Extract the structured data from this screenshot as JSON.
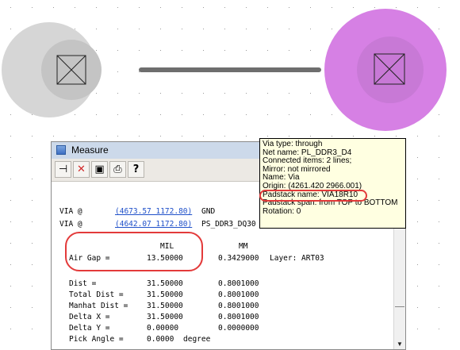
{
  "window": {
    "title": "Measure",
    "toolbar": {
      "pin_icon": "pin-icon",
      "delete_icon": "close-icon",
      "save_icon": "save-icon",
      "print_icon": "print-icon",
      "help_icon": "help-icon",
      "help_label": "?"
    },
    "rows": [
      {
        "label": "VIA @",
        "coord": "(4673.57 1172.80)",
        "net": "GND"
      },
      {
        "label": "VIA @",
        "coord": "(4642.07 1172.80)",
        "net": "PS_DDR3_DQ30"
      }
    ],
    "units": {
      "mil": "MIL",
      "mm": "MM"
    },
    "air_gap": {
      "label": "Air Gap =",
      "mil": "13.50000",
      "mm": "0.3429000",
      "layer": "Layer: ART03"
    },
    "measurements": [
      {
        "label": "Dist =",
        "mil": "31.50000",
        "mm": "0.8001000"
      },
      {
        "label": "Total Dist =",
        "mil": "31.50000",
        "mm": "0.8001000"
      },
      {
        "label": "Manhat Dist =",
        "mil": "31.50000",
        "mm": "0.8001000"
      },
      {
        "label": "Delta X =",
        "mil": "31.50000",
        "mm": "0.8001000"
      },
      {
        "label": "Delta Y =",
        "mil": "0.00000",
        "mm": "0.0000000"
      },
      {
        "label": "Pick Angle =",
        "mil": "0.0000",
        "mm": "degree"
      }
    ]
  },
  "tooltip": {
    "lines": [
      "Via type: through",
      "Net name: PL_DDR3_D4",
      "Connected items: 2 lines;",
      "Mirror: not mirrored",
      "Name: Via",
      "Origin: (4261.420 2966.001)",
      "Padstack name: VIA18R10",
      "Padstack span: from TOP to BOTTOM",
      "Rotation: 0"
    ]
  },
  "colors": {
    "left_pad": "#d6d6d6",
    "right_pad": "#d680e4",
    "trace": "#6e6e6e",
    "highlight": "#e33a3a"
  }
}
